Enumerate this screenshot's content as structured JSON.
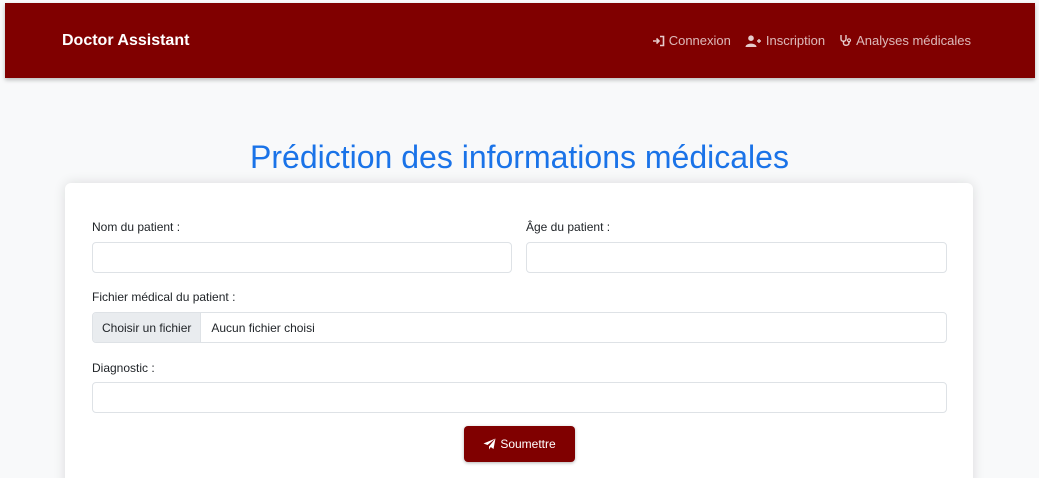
{
  "navbar": {
    "brand": "Doctor Assistant",
    "links": [
      {
        "label": "Connexion",
        "icon": "sign-in-icon"
      },
      {
        "label": "Inscription",
        "icon": "user-plus-icon"
      },
      {
        "label": "Analyses médicales",
        "icon": "stethoscope-icon"
      }
    ]
  },
  "main": {
    "title": "Prédiction des informations médicales"
  },
  "form": {
    "name_label": "Nom du patient :",
    "name_value": "",
    "age_label": "Âge du patient :",
    "age_value": "",
    "file_label": "Fichier médical du patient :",
    "file_button": "Choisir un fichier",
    "file_status": "Aucun fichier choisi",
    "diagnostic_label": "Diagnostic :",
    "diagnostic_value": "",
    "submit_label": "Soumettre"
  },
  "colors": {
    "navbar": "#800000",
    "title": "#1a73e8",
    "button": "#800000"
  }
}
